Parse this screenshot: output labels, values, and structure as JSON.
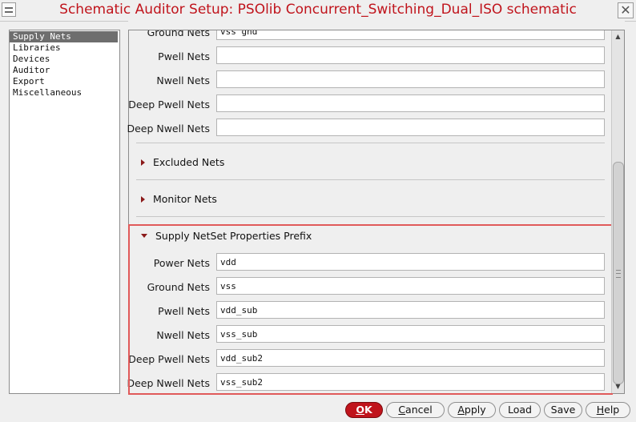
{
  "window": {
    "title": "Schematic Auditor Setup: PSOlib Concurrent_Switching_Dual_ISO schematic",
    "close_glyph": "✕"
  },
  "sidebar": {
    "items": [
      {
        "label": "Supply Nets",
        "selected": true
      },
      {
        "label": "Libraries",
        "selected": false
      },
      {
        "label": "Devices",
        "selected": false
      },
      {
        "label": "Auditor",
        "selected": false
      },
      {
        "label": "Export",
        "selected": false
      },
      {
        "label": "Miscellaneous",
        "selected": false
      }
    ]
  },
  "top_fields": [
    {
      "label": "Ground Nets",
      "value": "vss  gnd"
    },
    {
      "label": "Pwell Nets",
      "value": ""
    },
    {
      "label": "Nwell Nets",
      "value": ""
    },
    {
      "label": "Deep Pwell Nets",
      "value": ""
    },
    {
      "label": "Deep Nwell Nets",
      "value": ""
    }
  ],
  "sections": {
    "excluded": {
      "label": "Excluded Nets",
      "expanded": false
    },
    "monitor": {
      "label": "Monitor Nets",
      "expanded": false
    },
    "prefix": {
      "label": "Supply NetSet Properties Prefix",
      "expanded": true
    }
  },
  "prefix_fields": [
    {
      "label": "Power Nets",
      "value": "vdd"
    },
    {
      "label": "Ground Nets",
      "value": "vss"
    },
    {
      "label": "Pwell Nets",
      "value": "vdd_sub"
    },
    {
      "label": "Nwell Nets",
      "value": "vss_sub"
    },
    {
      "label": "Deep Pwell Nets",
      "value": "vdd_sub2"
    },
    {
      "label": "Deep Nwell Nets",
      "value": "vss_sub2"
    }
  ],
  "buttons": {
    "ok": {
      "mnemonic": "O",
      "rest": "K"
    },
    "cancel": {
      "mnemonic": "C",
      "rest": "ancel"
    },
    "apply": {
      "mnemonic": "A",
      "rest": "pply"
    },
    "load": {
      "mnemonic": "",
      "rest": "Load"
    },
    "save": {
      "mnemonic": "",
      "rest": "Save"
    },
    "help": {
      "mnemonic": "H",
      "rest": "elp"
    }
  },
  "colors": {
    "title": "#c0141c",
    "ok_button": "#c0141c",
    "highlight_border": "#e05a5a",
    "selection": "#6e6e6e",
    "expander_triangle": "#8b1a1a"
  }
}
